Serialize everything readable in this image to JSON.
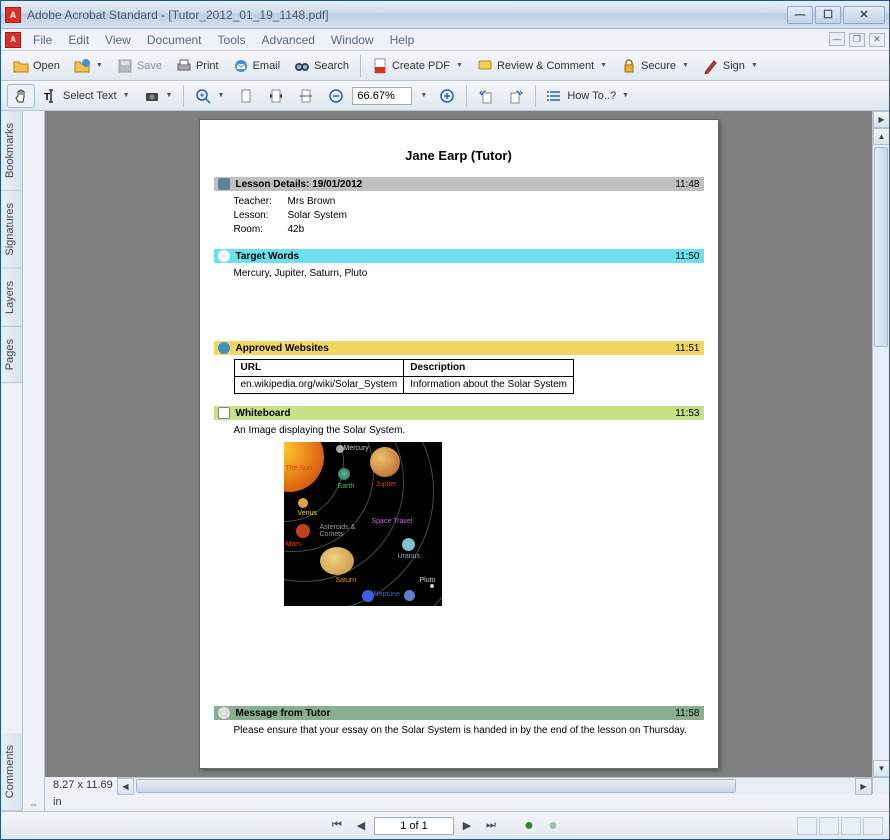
{
  "title": "Adobe Acrobat Standard - [Tutor_2012_01_19_1148.pdf]",
  "menu": {
    "file": "File",
    "edit": "Edit",
    "view": "View",
    "document": "Document",
    "tools": "Tools",
    "advanced": "Advanced",
    "window": "Window",
    "help": "Help"
  },
  "toolbar": {
    "open": "Open",
    "save": "Save",
    "print": "Print",
    "email": "Email",
    "search": "Search",
    "create_pdf": "Create PDF",
    "review_comment": "Review & Comment",
    "secure": "Secure",
    "sign": "Sign",
    "select_text": "Select Text",
    "zoom_value": "66.67%",
    "how_to": "How To..?"
  },
  "side_tabs": {
    "bookmarks": "Bookmarks",
    "signatures": "Signatures",
    "layers": "Layers",
    "pages": "Pages",
    "comments": "Comments"
  },
  "doc": {
    "title": "Jane Earp (Tutor)",
    "lesson_details": {
      "header": "Lesson Details: 19/01/2012",
      "time": "11:48",
      "teacher_k": "Teacher:",
      "teacher_v": "Mrs Brown",
      "lesson_k": "Lesson:",
      "lesson_v": "Solar System",
      "room_k": "Room:",
      "room_v": "42b"
    },
    "target_words": {
      "header": "Target Words",
      "time": "11:50",
      "body": "Mercury, Jupiter, Saturn, Pluto"
    },
    "approved_websites": {
      "header": "Approved Websites",
      "time": "11:51",
      "col1": "URL",
      "col2": "Description",
      "url": "en.wikipedia.org/wiki/Solar_System",
      "desc": "Information about the Solar System"
    },
    "whiteboard": {
      "header": "Whiteboard",
      "time": "11:53",
      "caption": "An Image displaying the Solar System."
    },
    "solar_labels": {
      "mercury": "Mercury",
      "sun": "The Sun",
      "earth": "Earth",
      "jupiter": "Jupiter",
      "venus": "Venus",
      "space_travel": "Space Travel",
      "mars": "Mars",
      "asteroids_comets": "Asteroids & Comets",
      "uranus": "Uranus",
      "saturn": "Saturn",
      "neptune": "Neptune",
      "pluto": "Pluto"
    },
    "message": {
      "header": "Message from Tutor",
      "time": "11:58",
      "body": "Please ensure that your essay on the Solar System is handed in by the end of the lesson on Thursday."
    }
  },
  "status": {
    "page_dim": "8.27 x 11.69 in",
    "page_of": "1 of 1"
  }
}
